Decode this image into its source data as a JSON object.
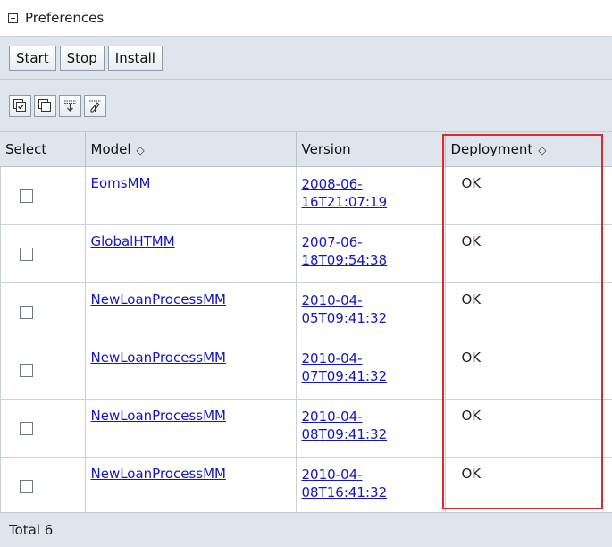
{
  "preferences": {
    "label": "Preferences"
  },
  "toolbar": {
    "buttons": [
      "Start",
      "Stop",
      "Install"
    ]
  },
  "icon_toolbar": [
    "select-all-icon",
    "deselect-all-icon",
    "expand-filter-icon",
    "edit-filter-icon"
  ],
  "table": {
    "headers": {
      "select": "Select",
      "model": "Model",
      "version": "Version",
      "deployment": "Deployment"
    },
    "rows": [
      {
        "model": "EomsMM",
        "version_line1": "2008-06-",
        "version_line2": "16T21:07:19",
        "deployment": "OK"
      },
      {
        "model": "GlobalHTMM",
        "version_line1": "2007-06-",
        "version_line2": "18T09:54:38",
        "deployment": "OK"
      },
      {
        "model": "NewLoanProcessMM",
        "version_line1": "2010-04-",
        "version_line2": "05T09:41:32",
        "deployment": "OK"
      },
      {
        "model": "NewLoanProcessMM",
        "version_line1": "2010-04-",
        "version_line2": "07T09:41:32",
        "deployment": "OK"
      },
      {
        "model": "NewLoanProcessMM",
        "version_line1": "2010-04-",
        "version_line2": "08T09:41:32",
        "deployment": "OK"
      },
      {
        "model": "NewLoanProcessMM",
        "version_line1": "2010-04-",
        "version_line2": "08T16:41:32",
        "deployment": "OK"
      }
    ]
  },
  "footer": {
    "total": "Total 6"
  },
  "colors": {
    "highlight": "#e1262c",
    "link": "#1515c8",
    "header_bg": "#dfe5ec"
  }
}
